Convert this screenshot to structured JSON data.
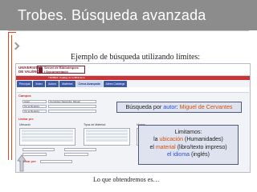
{
  "slide": {
    "title": "Trobes. Búsqueda avanzada",
    "subtitle": "Ejemplo  de búsqueda utilizando límites:",
    "caption": "Lo que obtendremos es…"
  },
  "app": {
    "university": "UNIVERSITAT\nDE VALÈNCIA",
    "library": "Servei de Biblioteques\ni Documentació",
    "breadcrumb": "TROBES: Catàleg de la Biblioteca",
    "tabs": [
      "Principal",
      "Índex",
      "Autors",
      "Matèries",
      "Cerca Avançada",
      "Altres Catàlegs"
    ],
    "active_tab": "Cerca Avançada",
    "panel_title": "Campos",
    "search_rows": [
      {
        "field": "Autor",
        "value": "Cervantes Saavedra, Miguel"
      },
      {
        "field": "Tot el Registre",
        "value": ""
      },
      {
        "field": "Tot el Registre",
        "value": ""
      }
    ],
    "limits_heading": "Limitar per:",
    "limit_groups": {
      "location": "Ubicació:",
      "material": "Tipus de Material:",
      "language": "Idioma:"
    },
    "sort_label": "Ordenar per:"
  },
  "callouts": {
    "author": {
      "prefix": "Búsqueda por",
      "field": "autor",
      "separator": ":",
      "value": "Miguel de Cervantes"
    },
    "limits": {
      "heading": "Limitamos:",
      "l1_pre": "la",
      "l1_key": "ubicación",
      "l1_post": "(Humanidades)",
      "l2_pre": "el",
      "l2_key": "material",
      "l2_post": "(libro/texto impreso)",
      "l3_key": "el idioma",
      "l3_post": "(inglés)"
    }
  },
  "colors": {
    "title_bar": "#8c8c8c",
    "accent_orange": "#d0520f",
    "accent_blue": "#2a4fd6",
    "bracket": "#d84a1b"
  }
}
